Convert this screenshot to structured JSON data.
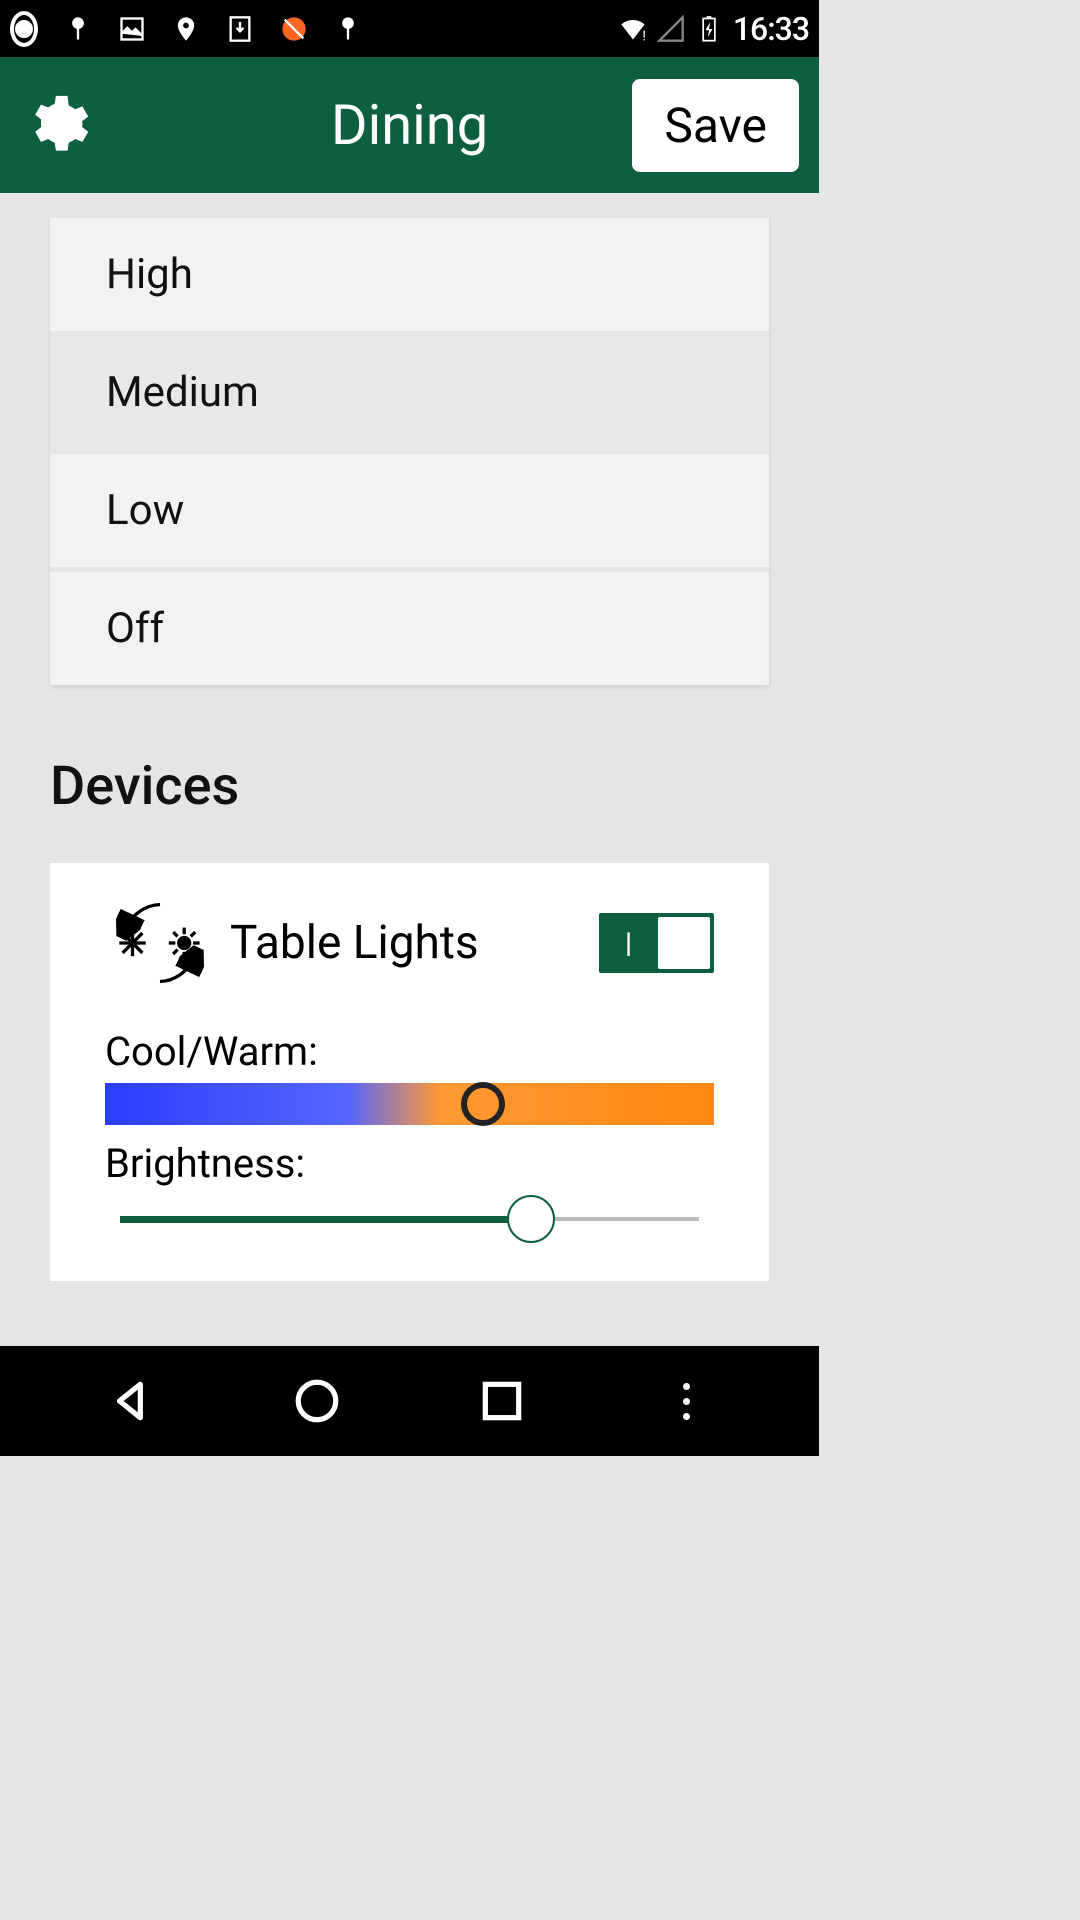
{
  "status_bar": {
    "time": "16:33"
  },
  "header": {
    "title": "Dining",
    "save_label": "Save"
  },
  "presets": [
    {
      "label": "High",
      "selected": false
    },
    {
      "label": "Medium",
      "selected": true
    },
    {
      "label": "Low",
      "selected": false
    },
    {
      "label": "Off",
      "selected": false
    }
  ],
  "sections": {
    "devices_title": "Devices"
  },
  "devices": [
    {
      "name": "Table Lights",
      "enabled": true,
      "cool_warm_label": "Cool/Warm:",
      "cool_warm_value": 62,
      "brightness_label": "Brightness:",
      "brightness_value": 70
    }
  ],
  "colors": {
    "primary": "#0d5f3f",
    "slider_cool": "#2a3fff",
    "slider_warm": "#ff8811"
  }
}
